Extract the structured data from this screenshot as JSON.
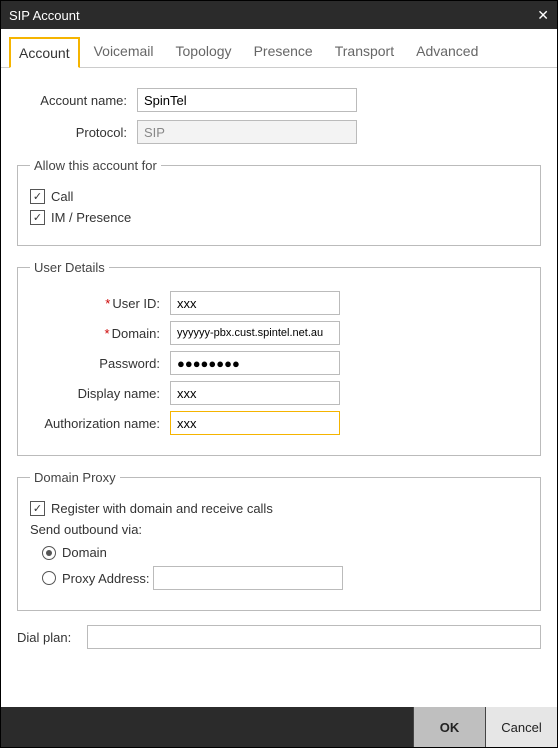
{
  "window": {
    "title": "SIP Account",
    "close": "✕"
  },
  "tabs": {
    "account": "Account",
    "voicemail": "Voicemail",
    "topology": "Topology",
    "presence": "Presence",
    "transport": "Transport",
    "advanced": "Advanced"
  },
  "labels": {
    "account_name": "Account name:",
    "protocol": "Protocol:",
    "allow_legend": "Allow this account for",
    "call": "Call",
    "im_presence": "IM / Presence",
    "user_details_legend": "User Details",
    "user_id": "User ID:",
    "domain": "Domain:",
    "password": "Password:",
    "display_name": "Display name:",
    "auth_name": "Authorization name:",
    "domain_proxy_legend": "Domain Proxy",
    "register": "Register with domain and receive calls",
    "send_outbound": "Send outbound via:",
    "radio_domain": "Domain",
    "radio_proxy": "Proxy  Address:",
    "dial_plan": "Dial plan:"
  },
  "values": {
    "account_name": "SpinTel",
    "protocol": "SIP",
    "allow_call": true,
    "allow_im": true,
    "user_id": "xxx",
    "domain": "yyyyyy-pbx.cust.spintel.net.au",
    "password": "●●●●●●●●",
    "display_name": "xxx",
    "auth_name": "xxx",
    "register_checked": true,
    "outbound_selected": "domain",
    "proxy_address": "",
    "dial_plan": ""
  },
  "footer": {
    "ok": "OK",
    "cancel": "Cancel"
  }
}
